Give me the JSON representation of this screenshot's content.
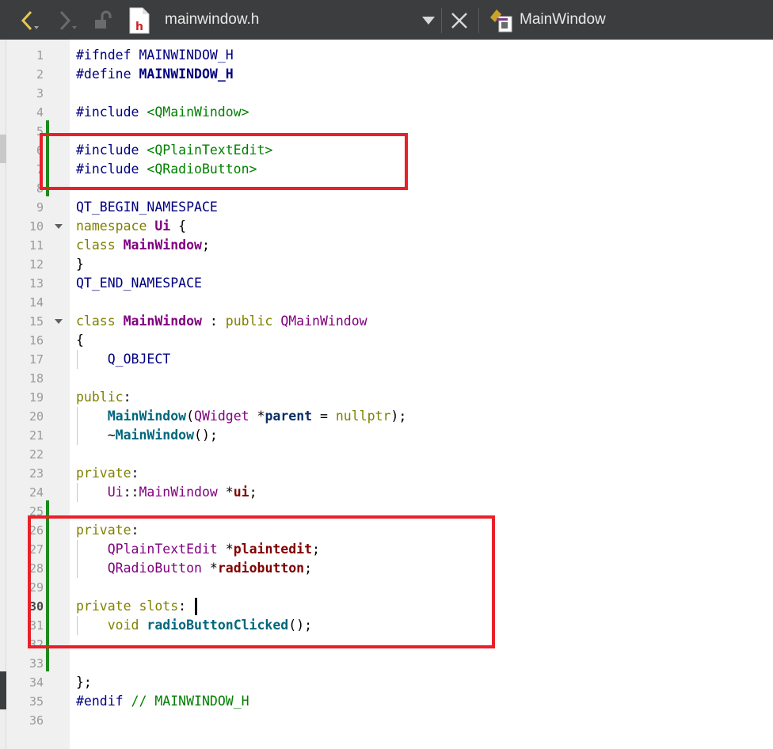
{
  "toolbar": {
    "back_icon": "chevron-left-icon",
    "forward_icon": "chevron-right-icon",
    "lock_icon": "unlocked-icon",
    "file_icon": "header-file-icon",
    "file_icon_letter": "h",
    "file_name": "mainwindow.h",
    "dropdown_icon": "triangle-down-icon",
    "close_icon": "close-icon",
    "symbol_icon": "class-symbol-icon",
    "symbol_name": "MainWindow"
  },
  "colors": {
    "toolbar_bg": "#3c3d3e",
    "highlight_box": "#e8202a",
    "diff_marker": "#1c8a1c",
    "keyword": "#808000",
    "type": "#800080",
    "string": "#008000",
    "preprocessor": "#000080"
  },
  "editor": {
    "current_line": 30,
    "lines": [
      {
        "n": "1",
        "tokens": [
          [
            "pp",
            "#ifndef "
          ],
          [
            "mac",
            "MAINWINDOW_H"
          ]
        ]
      },
      {
        "n": "2",
        "tokens": [
          [
            "pp",
            "#define "
          ],
          [
            "macb",
            "MAINWINDOW_H"
          ]
        ]
      },
      {
        "n": "3",
        "tokens": []
      },
      {
        "n": "4",
        "tokens": [
          [
            "pp",
            "#include "
          ],
          [
            "str",
            "<QMainWindow>"
          ]
        ]
      },
      {
        "n": "5",
        "tokens": []
      },
      {
        "n": "6",
        "tokens": [
          [
            "pp",
            "#include "
          ],
          [
            "str",
            "<QPlainTextEdit>"
          ]
        ]
      },
      {
        "n": "7",
        "tokens": [
          [
            "pp",
            "#include "
          ],
          [
            "str",
            "<QRadioButton>"
          ]
        ]
      },
      {
        "n": "8",
        "tokens": []
      },
      {
        "n": "9",
        "tokens": [
          [
            "mac",
            "QT_BEGIN_NAMESPACE"
          ]
        ]
      },
      {
        "n": "10",
        "fold": true,
        "tokens": [
          [
            "kw",
            "namespace "
          ],
          [
            "typeb",
            "Ui"
          ],
          [
            "plain",
            " {"
          ]
        ]
      },
      {
        "n": "11",
        "tokens": [
          [
            "kw",
            "class "
          ],
          [
            "typeb",
            "MainWindow"
          ],
          [
            "plain",
            ";"
          ]
        ]
      },
      {
        "n": "12",
        "tokens": [
          [
            "plain",
            "}"
          ]
        ]
      },
      {
        "n": "13",
        "tokens": [
          [
            "mac",
            "QT_END_NAMESPACE"
          ]
        ]
      },
      {
        "n": "14",
        "tokens": []
      },
      {
        "n": "15",
        "fold": true,
        "tokens": [
          [
            "kw",
            "class "
          ],
          [
            "typeb",
            "MainWindow"
          ],
          [
            "plain",
            " : "
          ],
          [
            "kw",
            "public "
          ],
          [
            "type",
            "QMainWindow"
          ]
        ]
      },
      {
        "n": "16",
        "tokens": [
          [
            "plain",
            "{"
          ]
        ]
      },
      {
        "n": "17",
        "tokens": [
          [
            "plain",
            "    "
          ],
          [
            "mac",
            "Q_OBJECT"
          ]
        ]
      },
      {
        "n": "18",
        "tokens": []
      },
      {
        "n": "19",
        "tokens": [
          [
            "kw",
            "public"
          ],
          [
            "plain",
            ":"
          ]
        ]
      },
      {
        "n": "20",
        "tokens": [
          [
            "plain",
            "    "
          ],
          [
            "fnb",
            "MainWindow"
          ],
          [
            "plain",
            "("
          ],
          [
            "type",
            "QWidget"
          ],
          [
            "plain",
            " *"
          ],
          [
            "pb",
            "parent"
          ],
          [
            "plain",
            " = "
          ],
          [
            "kw",
            "nullptr"
          ],
          [
            "plain",
            ");"
          ]
        ]
      },
      {
        "n": "21",
        "tokens": [
          [
            "plain",
            "    ~"
          ],
          [
            "fnb",
            "MainWindow"
          ],
          [
            "plain",
            "();"
          ]
        ]
      },
      {
        "n": "22",
        "tokens": []
      },
      {
        "n": "23",
        "tokens": [
          [
            "kw",
            "private"
          ],
          [
            "plain",
            ":"
          ]
        ]
      },
      {
        "n": "24",
        "tokens": [
          [
            "plain",
            "    "
          ],
          [
            "type",
            "Ui"
          ],
          [
            "plain",
            "::"
          ],
          [
            "type",
            "MainWindow"
          ],
          [
            "plain",
            " *"
          ],
          [
            "mb",
            "ui"
          ],
          [
            "plain",
            ";"
          ]
        ]
      },
      {
        "n": "25",
        "tokens": []
      },
      {
        "n": "26",
        "tokens": [
          [
            "kw",
            "private"
          ],
          [
            "plain",
            ":"
          ]
        ]
      },
      {
        "n": "27",
        "tokens": [
          [
            "plain",
            "    "
          ],
          [
            "type",
            "QPlainTextEdit"
          ],
          [
            "plain",
            " *"
          ],
          [
            "mb",
            "plaintedit"
          ],
          [
            "plain",
            ";"
          ]
        ]
      },
      {
        "n": "28",
        "tokens": [
          [
            "plain",
            "    "
          ],
          [
            "type",
            "QRadioButton"
          ],
          [
            "plain",
            " *"
          ],
          [
            "mb",
            "radiobutton"
          ],
          [
            "plain",
            ";"
          ]
        ]
      },
      {
        "n": "29",
        "tokens": []
      },
      {
        "n": "30",
        "tokens": [
          [
            "kw",
            "private slots"
          ],
          [
            "plain",
            ":"
          ]
        ]
      },
      {
        "n": "31",
        "tokens": [
          [
            "plain",
            "    "
          ],
          [
            "kw",
            "void "
          ],
          [
            "fnb",
            "radioButtonClicked"
          ],
          [
            "plain",
            "();"
          ]
        ]
      },
      {
        "n": "32",
        "tokens": []
      },
      {
        "n": "33",
        "tokens": []
      },
      {
        "n": "34",
        "tokens": [
          [
            "plain",
            "};"
          ]
        ]
      },
      {
        "n": "35",
        "tokens": [
          [
            "pp",
            "#endif "
          ],
          [
            "com",
            "// MAINWINDOW_H"
          ]
        ]
      },
      {
        "n": "36",
        "tokens": []
      }
    ]
  }
}
